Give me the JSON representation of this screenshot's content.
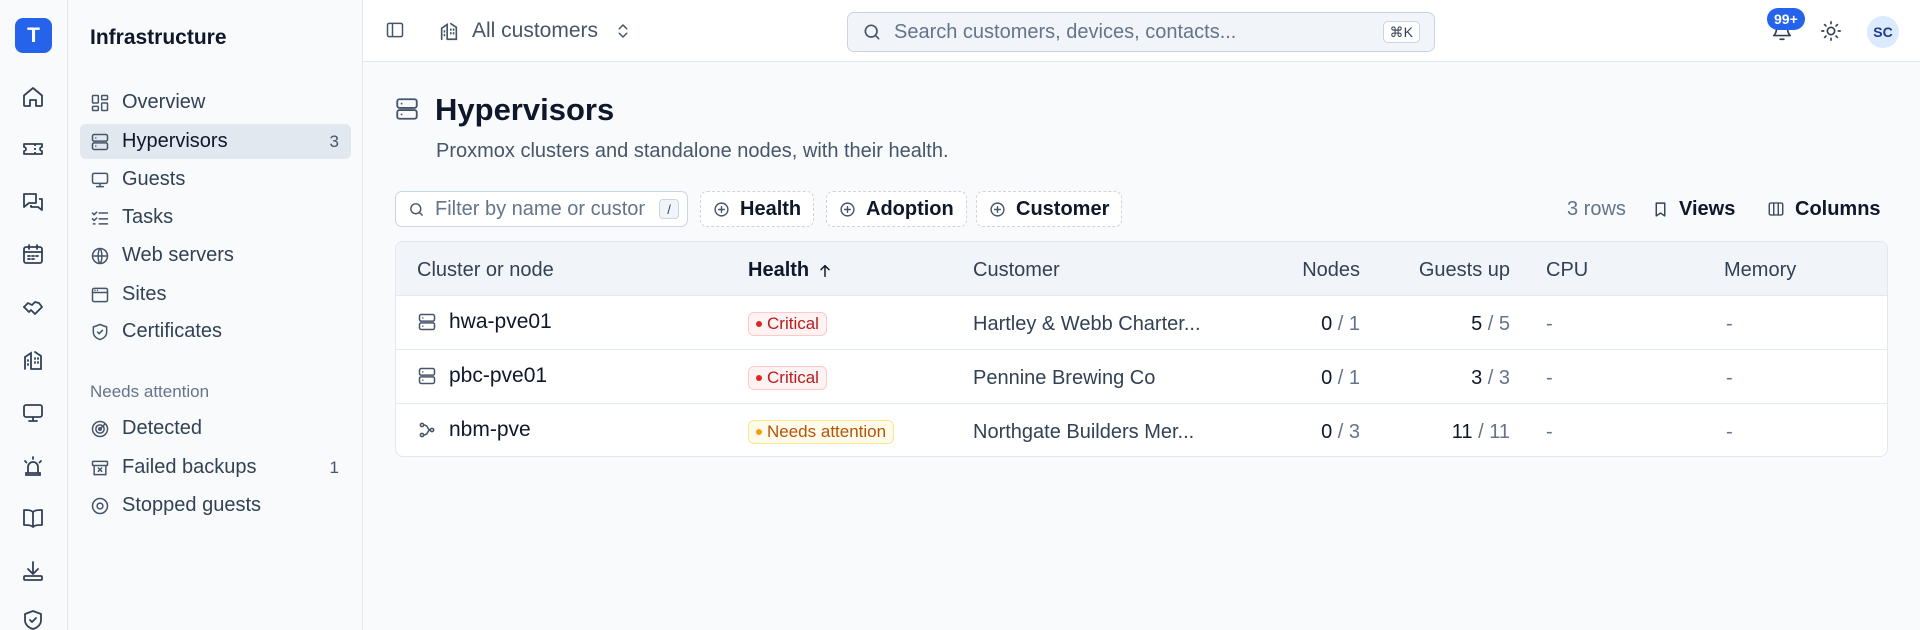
{
  "rail": {
    "logo": "T",
    "icons": [
      "home-icon",
      "ticket-icon",
      "messages-icon",
      "calendar-icon",
      "handshake-icon",
      "building-icon",
      "monitor-icon",
      "siren-icon",
      "book-icon",
      "download-icon",
      "shield-icon"
    ]
  },
  "sidebar": {
    "title": "Infrastructure",
    "items": [
      {
        "label": "Overview",
        "icon": "dashboard-icon"
      },
      {
        "label": "Hypervisors",
        "icon": "server-icon",
        "count": "3",
        "active": true
      },
      {
        "label": "Guests",
        "icon": "monitor-icon"
      },
      {
        "label": "Tasks",
        "icon": "list-checks-icon"
      },
      {
        "label": "Web servers",
        "icon": "globe-icon"
      },
      {
        "label": "Sites",
        "icon": "browser-icon"
      },
      {
        "label": "Certificates",
        "icon": "badge-check-icon"
      }
    ],
    "section_label": "Needs attention",
    "attention_items": [
      {
        "label": "Detected",
        "icon": "radar-icon"
      },
      {
        "label": "Failed backups",
        "icon": "archive-x-icon",
        "count": "1"
      },
      {
        "label": "Stopped guests",
        "icon": "stop-circle-icon"
      }
    ]
  },
  "header": {
    "customer_selector": "All customers",
    "search_placeholder": "Search customers, devices, contacts...",
    "search_shortcut": "⌘K",
    "notification_badge": "99+",
    "avatar_initials": "SC"
  },
  "page": {
    "title": "Hypervisors",
    "subtitle": "Proxmox clusters and standalone nodes, with their health."
  },
  "toolbar": {
    "filter_placeholder": "Filter by name or customer",
    "filter_shortcut": "/",
    "chips": [
      "Health",
      "Adoption",
      "Customer"
    ],
    "rows_count": "3 rows",
    "views_label": "Views",
    "columns_label": "Columns"
  },
  "table": {
    "columns": [
      "Cluster or node",
      "Health",
      "Customer",
      "Nodes",
      "Guests up",
      "CPU",
      "Memory"
    ],
    "rows": [
      {
        "name": "hwa-pve01",
        "icon": "server-icon",
        "health": "Critical",
        "customer": "Hartley & Webb Charter...",
        "nodes_up": "0",
        "nodes_total": "/ 1",
        "guests_up": "5",
        "guests_total": "/ 5",
        "cpu": "-",
        "memory": "-"
      },
      {
        "name": "pbc-pve01",
        "icon": "server-icon",
        "health": "Critical",
        "customer": "Pennine Brewing Co",
        "nodes_up": "0",
        "nodes_total": "/ 1",
        "guests_up": "3",
        "guests_total": "/ 3",
        "cpu": "-",
        "memory": "-"
      },
      {
        "name": "nbm-pve",
        "icon": "cluster-icon",
        "health": "Needs attention",
        "customer": "Northgate Builders Mer...",
        "nodes_up": "0",
        "nodes_total": "/ 3",
        "guests_up": "11",
        "guests_total": "/ 11",
        "cpu": "-",
        "memory": "-"
      }
    ]
  },
  "colors": {
    "accent": "#2563eb",
    "critical": "#dc2626",
    "warning": "#f59e0b"
  }
}
